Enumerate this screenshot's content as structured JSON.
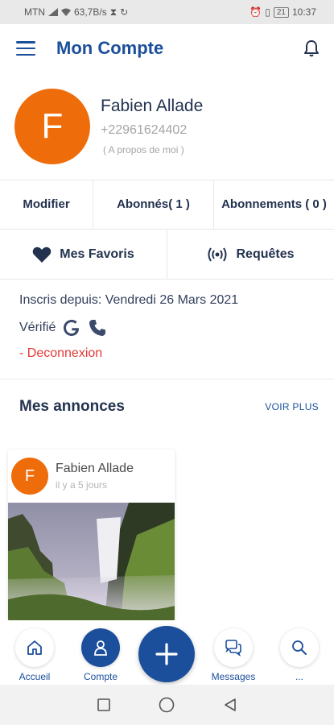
{
  "status_bar": {
    "carrier": "MTN",
    "speed": "63,7B/s",
    "battery": "21",
    "time": "10:37"
  },
  "header": {
    "title": "Mon Compte"
  },
  "profile": {
    "initial": "F",
    "name": "Fabien Allade",
    "phone": "+22961624402",
    "about": "( A propos de moi )",
    "avatar_color": "#ef6c0a"
  },
  "tabs": [
    {
      "label": "Modifier"
    },
    {
      "label": "Abonnés( 1 )"
    },
    {
      "label": "Abonnements ( 0 )"
    }
  ],
  "actions": {
    "favorites": "Mes Favoris",
    "requests": "Requêtes"
  },
  "info": {
    "since": "Inscris depuis: Vendredi 26 Mars 2021",
    "verified_label": "Vérifié",
    "logout": "- Deconnexion"
  },
  "annonces": {
    "title": "Mes annonces",
    "more": "VOIR PLUS",
    "card": {
      "initial": "F",
      "author": "Fabien Allade",
      "time": "il y a 5 jours"
    }
  },
  "bottom_nav": {
    "home": "Accueil",
    "account": "Compte",
    "messages": "Messages",
    "search": "..."
  },
  "colors": {
    "primary": "#1b4f9c",
    "accent": "#ef6c0a",
    "danger": "#e53935"
  }
}
